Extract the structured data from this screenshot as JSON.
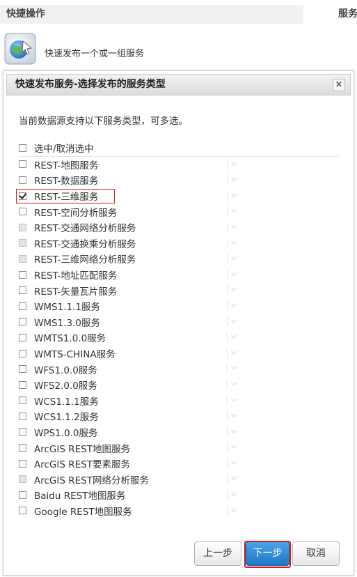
{
  "background": {
    "header_left": "快捷操作",
    "header_right": "服务",
    "quick_publish_desc": "快速发布一个或一组服务"
  },
  "dialog": {
    "title": "快速发布服务-选择发布的服务类型",
    "close_label": "×",
    "description": "当前数据源支持以下服务类型，可多选。",
    "select_all_label": "选中/取消选中",
    "items": [
      {
        "label": "REST-地图服务",
        "checked": false,
        "disabled": false
      },
      {
        "label": "REST-数据服务",
        "checked": false,
        "disabled": false
      },
      {
        "label": "REST-三维服务",
        "checked": true,
        "disabled": false
      },
      {
        "label": "REST-空间分析服务",
        "checked": false,
        "disabled": false
      },
      {
        "label": "REST-交通网络分析服务",
        "checked": false,
        "disabled": true
      },
      {
        "label": "REST-交通换乘分析服务",
        "checked": false,
        "disabled": true
      },
      {
        "label": "REST-三维网络分析服务",
        "checked": false,
        "disabled": true
      },
      {
        "label": "REST-地址匹配服务",
        "checked": false,
        "disabled": false
      },
      {
        "label": "REST-矢量瓦片服务",
        "checked": false,
        "disabled": false
      },
      {
        "label": "WMS1.1.1服务",
        "checked": false,
        "disabled": false
      },
      {
        "label": "WMS1.3.0服务",
        "checked": false,
        "disabled": false
      },
      {
        "label": "WMTS1.0.0服务",
        "checked": false,
        "disabled": false
      },
      {
        "label": "WMTS-CHINA服务",
        "checked": false,
        "disabled": false
      },
      {
        "label": "WFS1.0.0服务",
        "checked": false,
        "disabled": false
      },
      {
        "label": "WFS2.0.0服务",
        "checked": false,
        "disabled": false
      },
      {
        "label": "WCS1.1.1服务",
        "checked": false,
        "disabled": false
      },
      {
        "label": "WCS1.1.2服务",
        "checked": false,
        "disabled": false
      },
      {
        "label": "WPS1.0.0服务",
        "checked": false,
        "disabled": false
      },
      {
        "label": "ArcGIS REST地图服务",
        "checked": false,
        "disabled": false
      },
      {
        "label": "ArcGIS REST要素服务",
        "checked": false,
        "disabled": false
      },
      {
        "label": "ArcGIS REST网络分析服务",
        "checked": false,
        "disabled": true
      },
      {
        "label": "Baidu REST地图服务",
        "checked": false,
        "disabled": false
      },
      {
        "label": "Google REST地图服务",
        "checked": false,
        "disabled": false
      }
    ],
    "buttons": {
      "prev": "上一步",
      "next": "下一步",
      "cancel": "取消"
    }
  },
  "colors": {
    "highlight": "#d21c1c",
    "primary": "#1f78c8"
  }
}
